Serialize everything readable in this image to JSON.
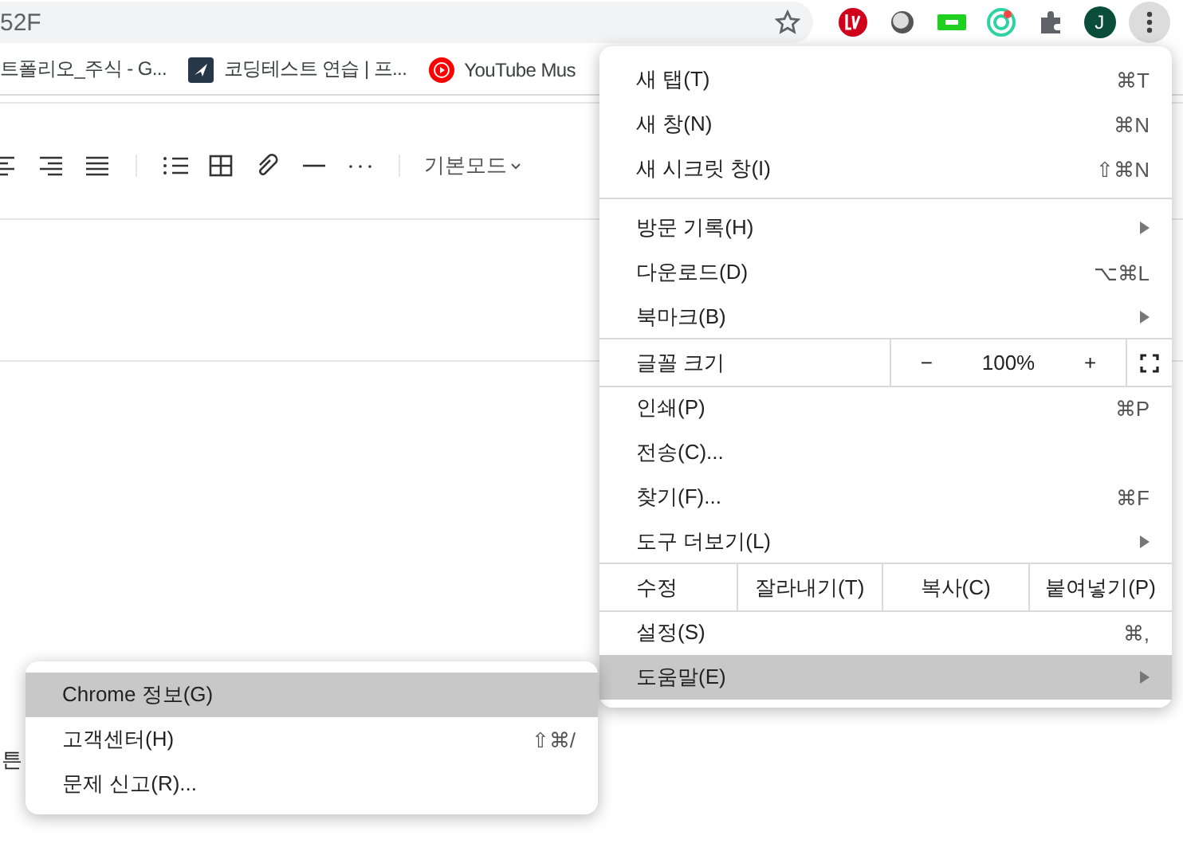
{
  "address_bar": {
    "text": "52F"
  },
  "profile": {
    "initial": "J"
  },
  "bookmarks": [
    {
      "label": "트폴리오_주식 - G...",
      "kind": "cut"
    },
    {
      "label": "코딩테스트 연습 | 프...",
      "kind": "code"
    },
    {
      "label": "YouTube Mus",
      "kind": "youtube"
    }
  ],
  "editor_toolbar": {
    "mode": "기본모드"
  },
  "page_text": "튼",
  "menu": {
    "items": [
      {
        "kind": "item",
        "label": "새 탭(T)",
        "shortcut": "⌘T",
        "submenu": false,
        "selected": false
      },
      {
        "kind": "item",
        "label": "새 창(N)",
        "shortcut": "⌘N",
        "submenu": false,
        "selected": false
      },
      {
        "kind": "item",
        "label": "새 시크릿 창(I)",
        "shortcut": "⇧⌘N",
        "submenu": false,
        "selected": false
      },
      {
        "kind": "divider"
      },
      {
        "kind": "item",
        "label": "방문 기록(H)",
        "submenu": true,
        "selected": false
      },
      {
        "kind": "item",
        "label": "다운로드(D)",
        "shortcut": "⌥⌘L",
        "submenu": false,
        "selected": false
      },
      {
        "kind": "item",
        "label": "북마크(B)",
        "submenu": true,
        "selected": false
      },
      {
        "kind": "zoom",
        "label": "글꼴 크기",
        "minus": "−",
        "value": "100%",
        "plus": "+"
      },
      {
        "kind": "item",
        "label": "인쇄(P)",
        "shortcut": "⌘P",
        "submenu": false,
        "selected": false
      },
      {
        "kind": "item",
        "label": "전송(C)...",
        "submenu": false,
        "selected": false
      },
      {
        "kind": "item",
        "label": "찾기(F)...",
        "shortcut": "⌘F",
        "submenu": false,
        "selected": false
      },
      {
        "kind": "item",
        "label": "도구 더보기(L)",
        "submenu": true,
        "selected": false
      },
      {
        "kind": "edit",
        "label": "수정",
        "actions": [
          "잘라내기(T)",
          "복사(C)",
          "붙여넣기(P)"
        ]
      },
      {
        "kind": "item",
        "label": "설정(S)",
        "shortcut": "⌘,",
        "submenu": false,
        "selected": false
      },
      {
        "kind": "item",
        "label": "도움말(E)",
        "submenu": true,
        "selected": true
      }
    ]
  },
  "help_submenu": {
    "items": [
      {
        "kind": "item",
        "label": "Chrome 정보(G)",
        "submenu": false,
        "selected": true
      },
      {
        "kind": "item",
        "label": "고객센터(H)",
        "shortcut": "⇧⌘/",
        "submenu": false,
        "selected": false
      },
      {
        "kind": "item",
        "label": "문제 신고(R)...",
        "submenu": false,
        "selected": false
      }
    ]
  }
}
